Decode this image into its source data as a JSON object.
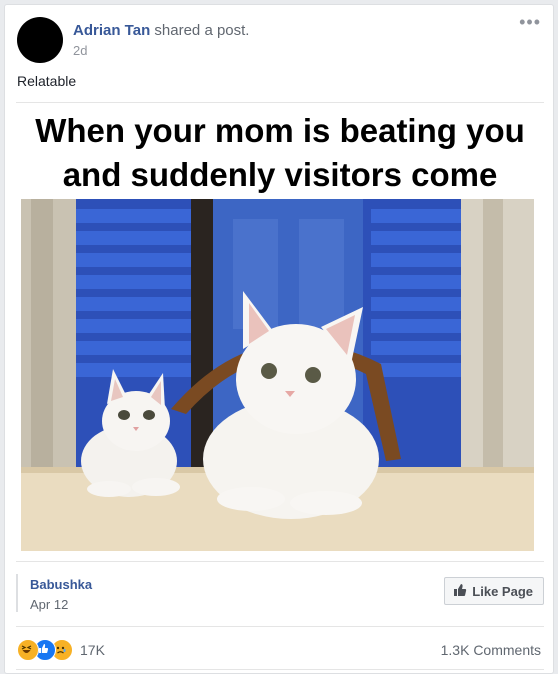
{
  "post": {
    "author": "Adrian Tan",
    "action": "shared a post.",
    "time": "2d",
    "more_icon": "more-horizontal-icon",
    "text": "Relatable"
  },
  "meme": {
    "caption_line1": "When your mom is beating you",
    "caption_line2": "and suddenly visitors come"
  },
  "shared_page": {
    "name": "Babushka",
    "date": "Apr 12",
    "like_button": "Like Page"
  },
  "engagement": {
    "reaction_icons": [
      "haha-icon",
      "like-icon",
      "sad-icon"
    ],
    "reaction_count": "17K",
    "comments": "1.3K Comments"
  },
  "colors": {
    "link_blue": "#385898",
    "like_blue": "#1877f2",
    "reaction_yellow": "#f7b125"
  }
}
